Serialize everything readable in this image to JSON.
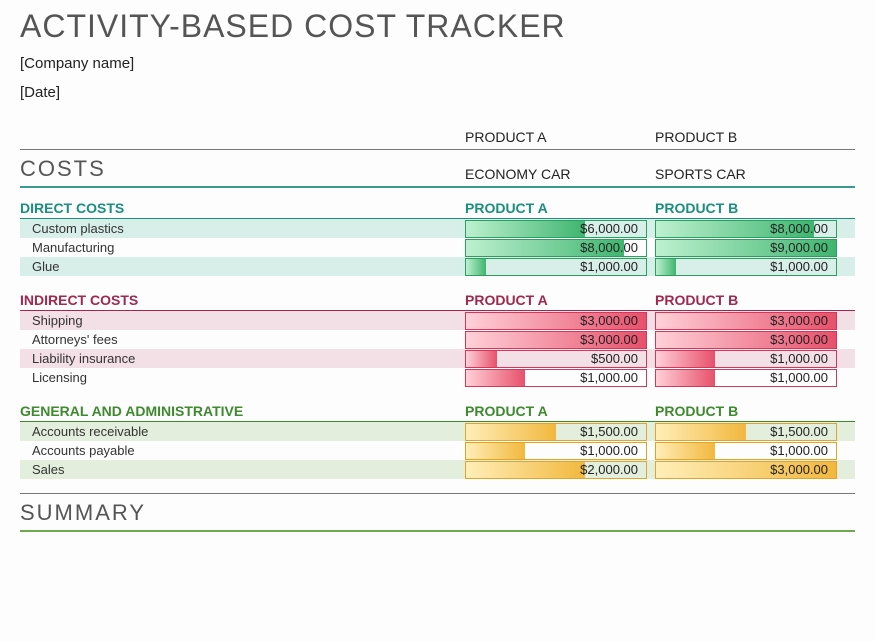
{
  "title": "ACTIVITY-BASED COST TRACKER",
  "company_placeholder": "[Company name]",
  "date_placeholder": "[Date]",
  "products": {
    "a": {
      "label": "PRODUCT A",
      "desc": "ECONOMY CAR"
    },
    "b": {
      "label": "PRODUCT B",
      "desc": "SPORTS CAR"
    }
  },
  "sections": {
    "costs": "COSTS",
    "summary": "SUMMARY"
  },
  "groups": {
    "direct": {
      "label": "DIRECT COSTS",
      "colA": "PRODUCT A",
      "colB": "PRODUCT B"
    },
    "indirect": {
      "label": "INDIRECT COSTS",
      "colA": "PRODUCT A",
      "colB": "PRODUCT B"
    },
    "genadmin": {
      "label": "GENERAL AND ADMINISTRATIVE",
      "colA": "PRODUCT A",
      "colB": "PRODUCT B"
    }
  },
  "rows": {
    "direct": [
      {
        "label": "Custom plastics",
        "a": "$6,000.00",
        "a_pct": 66,
        "b": "$8,000.00",
        "b_pct": 88
      },
      {
        "label": "Manufacturing",
        "a": "$8,000.00",
        "a_pct": 88,
        "b": "$9,000.00",
        "b_pct": 100
      },
      {
        "label": "Glue",
        "a": "$1,000.00",
        "a_pct": 11,
        "b": "$1,000.00",
        "b_pct": 11
      }
    ],
    "indirect": [
      {
        "label": "Shipping",
        "a": "$3,000.00",
        "a_pct": 100,
        "b": "$3,000.00",
        "b_pct": 100
      },
      {
        "label": "Attorneys' fees",
        "a": "$3,000.00",
        "a_pct": 100,
        "b": "$3,000.00",
        "b_pct": 100
      },
      {
        "label": "Liability insurance",
        "a": "$500.00",
        "a_pct": 17,
        "b": "$1,000.00",
        "b_pct": 33
      },
      {
        "label": "Licensing",
        "a": "$1,000.00",
        "a_pct": 33,
        "b": "$1,000.00",
        "b_pct": 33
      }
    ],
    "genadmin": [
      {
        "label": "Accounts receivable",
        "a": "$1,500.00",
        "a_pct": 50,
        "b": "$1,500.00",
        "b_pct": 50
      },
      {
        "label": "Accounts payable",
        "a": "$1,000.00",
        "a_pct": 33,
        "b": "$1,000.00",
        "b_pct": 33
      },
      {
        "label": "Sales",
        "a": "$2,000.00",
        "a_pct": 66,
        "b": "$3,000.00",
        "b_pct": 100
      }
    ]
  },
  "chart_data": {
    "type": "table",
    "title": "Activity-Based Cost Tracker",
    "categories": [
      "Product A (Economy Car)",
      "Product B (Sports Car)"
    ],
    "series": [
      {
        "group": "Direct Costs",
        "name": "Custom plastics",
        "values": [
          6000,
          8000
        ]
      },
      {
        "group": "Direct Costs",
        "name": "Manufacturing",
        "values": [
          8000,
          9000
        ]
      },
      {
        "group": "Direct Costs",
        "name": "Glue",
        "values": [
          1000,
          1000
        ]
      },
      {
        "group": "Indirect Costs",
        "name": "Shipping",
        "values": [
          3000,
          3000
        ]
      },
      {
        "group": "Indirect Costs",
        "name": "Attorneys' fees",
        "values": [
          3000,
          3000
        ]
      },
      {
        "group": "Indirect Costs",
        "name": "Liability insurance",
        "values": [
          500,
          1000
        ]
      },
      {
        "group": "Indirect Costs",
        "name": "Licensing",
        "values": [
          1000,
          1000
        ]
      },
      {
        "group": "General and Administrative",
        "name": "Accounts receivable",
        "values": [
          1500,
          1500
        ]
      },
      {
        "group": "General and Administrative",
        "name": "Accounts payable",
        "values": [
          1000,
          1000
        ]
      },
      {
        "group": "General and Administrative",
        "name": "Sales",
        "values": [
          2000,
          3000
        ]
      }
    ],
    "unit": "USD"
  }
}
